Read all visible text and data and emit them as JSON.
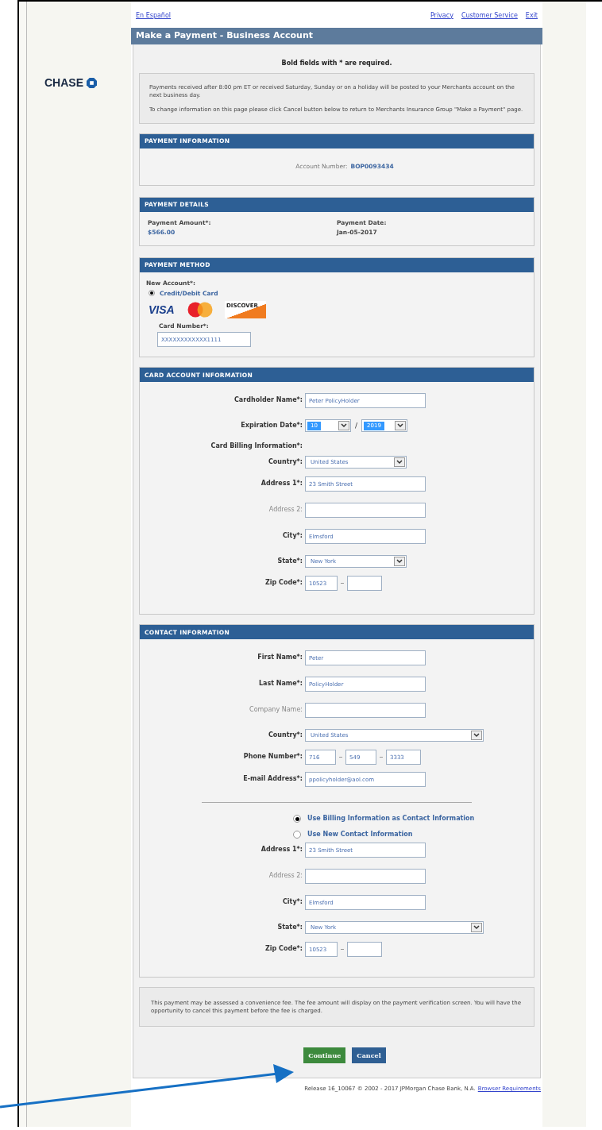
{
  "top_links": {
    "language": "En Español",
    "right": [
      "Privacy",
      "Customer Service",
      "Exit"
    ]
  },
  "logo": "CHASE",
  "title": "Make a Payment - Business Account",
  "required_note": "Bold fields with * are required.",
  "notice": [
    "Payments received after 8:00 pm ET or received Saturday, Sunday or on a holiday will be posted to your Merchants account on the next business day.",
    "To change information on this page please click Cancel button below to return to Merchants Insurance Group \"Make a Payment\" page."
  ],
  "payment_information": {
    "heading": "PAYMENT INFORMATION",
    "label": "Account Number:",
    "value": "BOP0093434"
  },
  "payment_details": {
    "heading": "PAYMENT DETAILS",
    "items": [
      {
        "label": "Payment Amount*:",
        "value": "$566.00",
        "link": true
      },
      {
        "label": "Payment Date:",
        "value": "Jan-05-2017",
        "link": false
      }
    ]
  },
  "payment_method": {
    "heading": "PAYMENT METHOD",
    "label": "New Account*:",
    "option": {
      "label": "Credit/Debit Card",
      "selected": true
    },
    "card_logos": [
      "VISA",
      "DISCOVER"
    ],
    "card_number": {
      "label": "Card Number*:",
      "value": "XXXXXXXXXXXX1111"
    }
  },
  "card_account": {
    "heading": "CARD ACCOUNT INFORMATION",
    "rows": [
      {
        "kind": "text",
        "label": "Cardholder Name*:",
        "required": true,
        "value": "Peter PolicyHolder"
      },
      {
        "kind": "date",
        "label": "Expiration Date*:",
        "required": true,
        "month": "10",
        "separator": "/",
        "year": "2019"
      },
      {
        "kind": "label",
        "label": "Card Billing Information*:",
        "required": true
      },
      {
        "kind": "select",
        "label": "Country*:",
        "required": true,
        "value": "United States",
        "wide": false
      },
      {
        "kind": "text",
        "label": "Address 1*:",
        "required": true,
        "value": "23 Smith Street"
      },
      {
        "kind": "text",
        "label": "Address 2:",
        "required": false
      },
      {
        "kind": "text",
        "label": "City*:",
        "required": true,
        "value": "Elmsford"
      },
      {
        "kind": "select",
        "label": "State*:",
        "required": true,
        "value": "New York",
        "wide": false
      },
      {
        "kind": "zip",
        "label": "Zip Code*:",
        "required": true,
        "value": "10523"
      }
    ]
  },
  "contact": {
    "heading": "CONTACT INFORMATION",
    "rows": [
      {
        "kind": "text",
        "label": "First Name*:",
        "required": true,
        "value": "Peter"
      },
      {
        "kind": "text",
        "label": "Last Name*:",
        "required": true,
        "value": "PolicyHolder"
      },
      {
        "kind": "text",
        "label": "Company Name:",
        "required": false
      },
      {
        "kind": "select",
        "label": "Country*:",
        "required": true,
        "value": "United States",
        "wide": true
      },
      {
        "kind": "phone",
        "label": "Phone Number*:",
        "required": true,
        "parts": [
          "716",
          "549",
          "3333"
        ]
      },
      {
        "kind": "text",
        "label": "E-mail Address*:",
        "required": true,
        "value": "ppolicyholder@aol.com"
      },
      {
        "kind": "rule"
      },
      {
        "kind": "radio",
        "label": "Use Billing Information as Contact Information",
        "selected": true
      },
      {
        "kind": "radio",
        "label": "Use New Contact Information",
        "selected": false
      },
      {
        "kind": "text",
        "label": "Address 1*:",
        "required": true,
        "value": "23 Smith Street"
      },
      {
        "kind": "text",
        "label": "Address 2:",
        "required": false
      },
      {
        "kind": "text",
        "label": "City*:",
        "required": true,
        "value": "Elmsford"
      },
      {
        "kind": "select",
        "label": "State*:",
        "required": true,
        "value": "New York",
        "wide": true
      },
      {
        "kind": "zip",
        "label": "Zip Code*:",
        "required": true,
        "value": "10523"
      }
    ]
  },
  "fee_note": "This payment may be assessed a convenience fee. The fee amount will display on the payment verification screen. You will have the opportunity to cancel this payment before the fee is charged.",
  "buttons": [
    "Continue",
    "Cancel"
  ],
  "footer": {
    "text": "Release 16_10067 © 2002 - 2017 JPMorgan Chase Bank, N.A.",
    "link": "Browser Requirements"
  }
}
